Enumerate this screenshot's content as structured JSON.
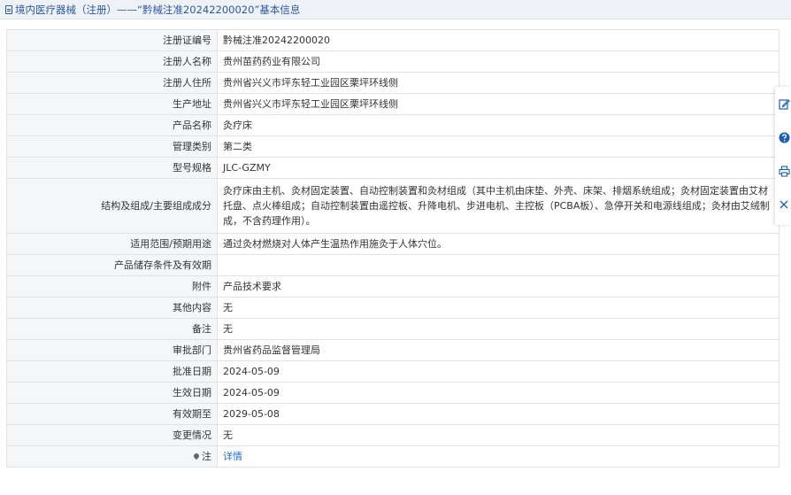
{
  "header": {
    "title": "境内医疗器械（注册）——“黔械注准20242200020”基本信息",
    "icon": "document-icon"
  },
  "rows": [
    {
      "label": "注册证编号",
      "value": "黔械注准20242200020"
    },
    {
      "label": "注册人名称",
      "value": "贵州苗药药业有限公司"
    },
    {
      "label": "注册人住所",
      "value": "贵州省兴义市坪东轻工业园区栗坪环线侧"
    },
    {
      "label": "生产地址",
      "value": "贵州省兴义市坪东轻工业园区栗坪环线侧"
    },
    {
      "label": "产品名称",
      "value": "灸疗床"
    },
    {
      "label": "管理类别",
      "value": "第二类"
    },
    {
      "label": "型号规格",
      "value": "JLC-GZMY"
    },
    {
      "label": "结构及组成/主要组成成分",
      "value": "灸疗床由主机、灸材固定装置、自动控制装置和灸材组成（其中主机由床垫、外壳、床架、排烟系统组成；灸材固定装置由艾材托盘、点火棒组成；自动控制装置由遥控板、升降电机、步进电机、主控板（PCBA板）、急停开关和电源线组成；灸材由艾绒制成，不含药理作用）。"
    },
    {
      "label": "适用范围/预期用途",
      "value": "通过灸材燃烧对人体产生温热作用施灸于人体穴位。"
    },
    {
      "label": "产品储存条件及有效期",
      "value": ""
    },
    {
      "label": "附件",
      "value": "产品技术要求"
    },
    {
      "label": "其他内容",
      "value": "无"
    },
    {
      "label": "备注",
      "value": "无"
    },
    {
      "label": "审批部门",
      "value": "贵州省药品监督管理局"
    },
    {
      "label": "批准日期",
      "value": "2024-05-09"
    },
    {
      "label": "生效日期",
      "value": "2024-05-09"
    },
    {
      "label": "有效期至",
      "value": "2029-05-08"
    },
    {
      "label": "变更情况",
      "value": "无"
    }
  ],
  "note": {
    "label": "注",
    "link_text": "详情",
    "icon": "pin-icon"
  },
  "side_toolbar": [
    "edit-icon",
    "help-icon",
    "print-icon",
    "close-icon"
  ],
  "colors": {
    "title_text": "#2c5aa0",
    "link": "#1e6fd6",
    "label_bg": "#f5f6f8",
    "help_icon": "#1a5fb4"
  }
}
